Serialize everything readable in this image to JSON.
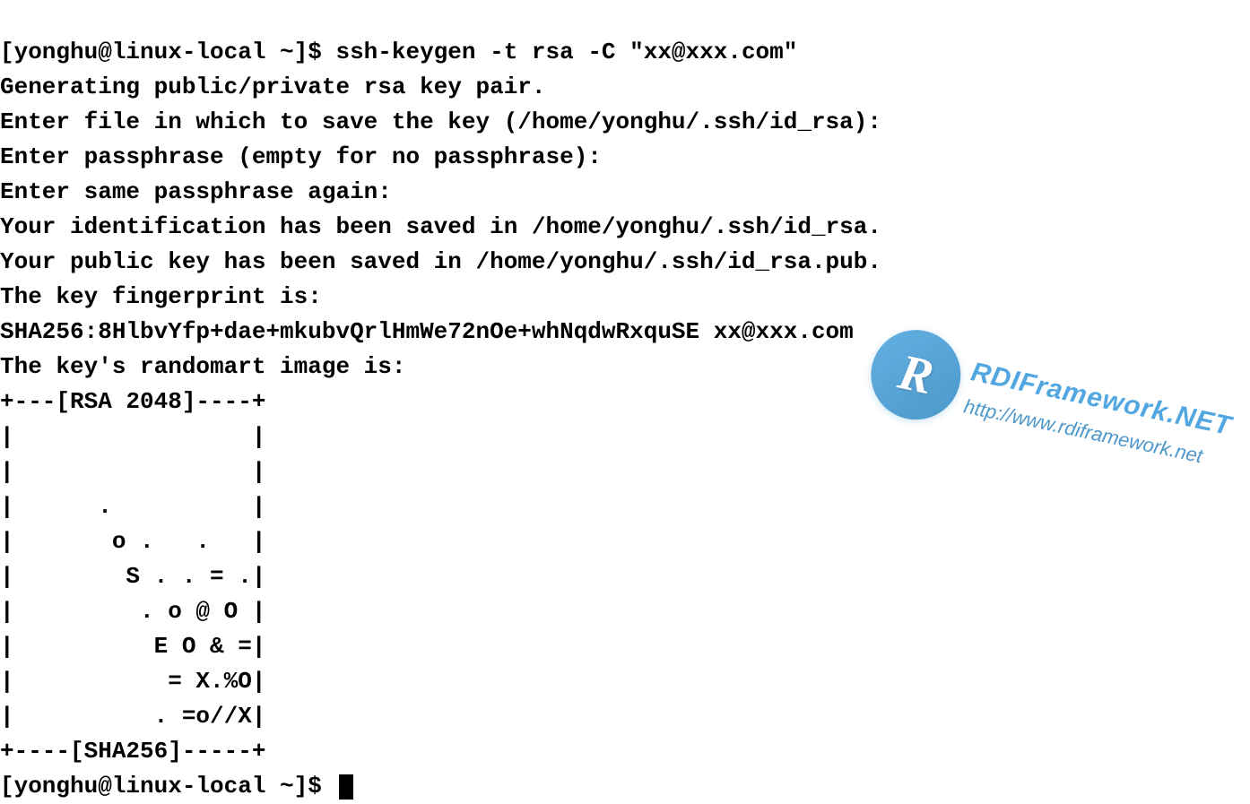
{
  "terminal": {
    "prompt1": "[yonghu@linux-local ~]$ ",
    "command": "ssh-keygen -t rsa -C \"xx@xxx.com\"",
    "line_generating": "Generating public/private rsa key pair.",
    "line_enter_file": "Enter file in which to save the key (/home/yonghu/.ssh/id_rsa):",
    "line_passphrase": "Enter passphrase (empty for no passphrase):",
    "line_passphrase_again": "Enter same passphrase again:",
    "line_id_saved": "Your identification has been saved in /home/yonghu/.ssh/id_rsa.",
    "line_pub_saved": "Your public key has been saved in /home/yonghu/.ssh/id_rsa.pub.",
    "line_fingerprint_intro": "The key fingerprint is:",
    "line_fingerprint": "SHA256:8HlbvYfp+dae+mkubvQrlHmWe72nOe+whNqdwRxquSE xx@xxx.com",
    "line_randomart_intro": "The key's randomart image is:",
    "randomart": {
      "top": "+---[RSA 2048]----+",
      "r1": "|                 |",
      "r2": "|                 |",
      "r3": "|      .          |",
      "r4": "|       o .   .   |",
      "r5": "|        S . . = .|",
      "r6": "|         . o @ O |",
      "r7": "|          E O & =|",
      "r8": "|           = X.%O|",
      "r9": "|          . =o//X|",
      "bottom": "+----[SHA256]-----+"
    },
    "prompt2": "[yonghu@linux-local ~]$ "
  },
  "watermark": {
    "logo_letter": "R",
    "title": "RDIFramework.NET",
    "url": "http://www.rdiframework.net"
  }
}
